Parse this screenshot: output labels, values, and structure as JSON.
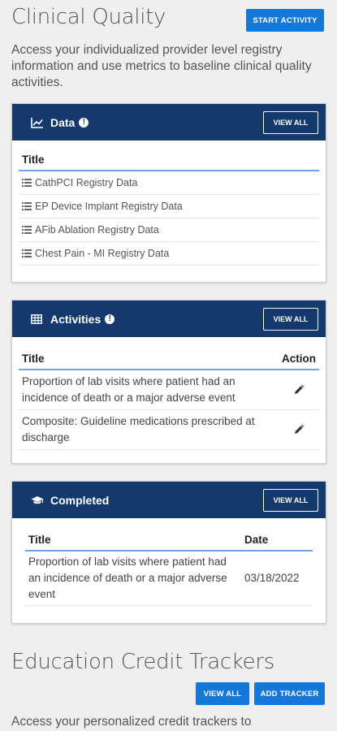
{
  "header": {
    "title": "Clinical Quality",
    "start_activity_label": "START ACTIVITY",
    "intro": "Access your individualized provider level registry information and use metrics to baseline clinical quality activities."
  },
  "data_card": {
    "title": "Data",
    "view_all_label": "VIEW ALL",
    "column_title": "Title",
    "rows": [
      "CathPCI Registry Data",
      "EP Device Implant Registry Data",
      "AFib Ablation Registry Data",
      "Chest Pain - MI Registry Data"
    ]
  },
  "activities_card": {
    "title": "Activities",
    "view_all_label": "VIEW ALL",
    "column_title": "Title",
    "column_action": "Action",
    "rows": [
      "Proportion of lab visits where patient had an incidence of death or a major adverse event",
      "Composite: Guideline medications prescribed at discharge"
    ]
  },
  "completed_card": {
    "title": "Completed",
    "view_all_label": "VIEW ALL",
    "column_title": "Title",
    "column_date": "Date",
    "rows": [
      {
        "title": "Proportion of lab visits where patient had an incidence of death or a major adverse event",
        "date": "03/18/2022"
      }
    ]
  },
  "education": {
    "title": "Education Credit Trackers",
    "view_all_label": "VIEW ALL",
    "add_tracker_label": "ADD TRACKER",
    "intro": "Access your personalized credit trackers to"
  },
  "colors": {
    "card_header": "#143a6d",
    "primary_button": "#1577d8",
    "table_rule": "#6fa6e0"
  },
  "icons": {
    "data": "line-chart-icon",
    "activities": "table-grid-icon",
    "completed": "graduation-cap-icon",
    "row": "list-icon",
    "action": "pencil-icon",
    "info": "info-icon"
  }
}
